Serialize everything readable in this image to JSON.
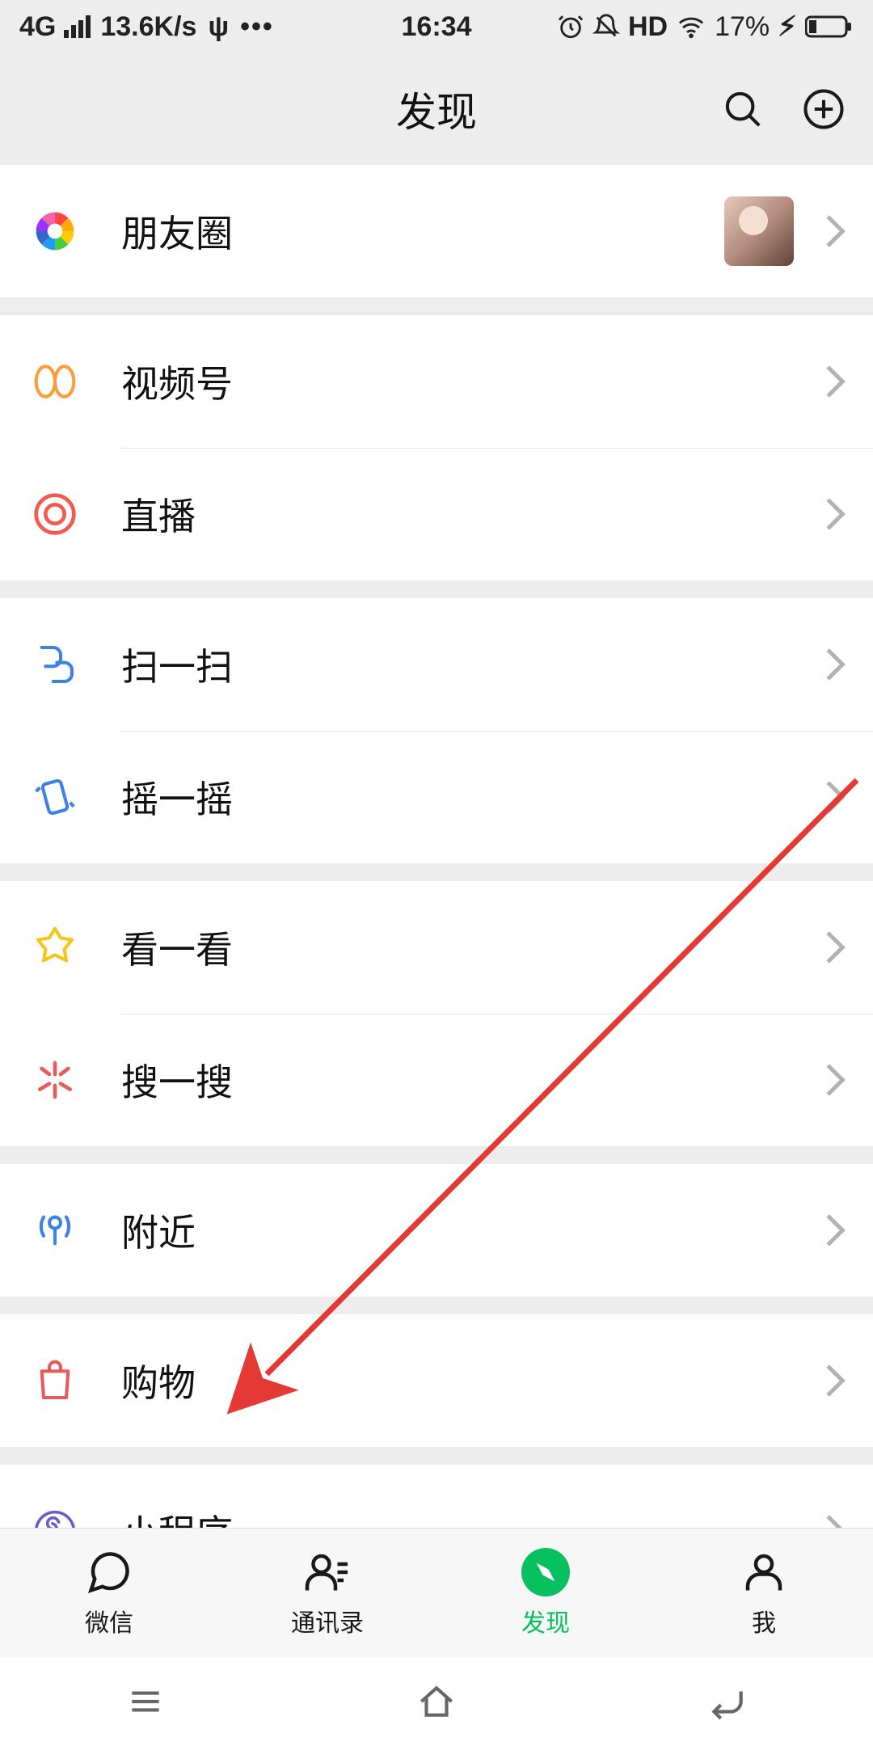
{
  "status": {
    "network": "4G",
    "speed": "13.6K/s",
    "time": "16:34",
    "hd": "HD",
    "battery": "17%"
  },
  "header": {
    "title": "发现"
  },
  "items": {
    "moments": "朋友圈",
    "channels": "视频号",
    "live": "直播",
    "scan": "扫一扫",
    "shake": "摇一摇",
    "topstories": "看一看",
    "search": "搜一搜",
    "nearby": "附近",
    "shopping": "购物",
    "miniprograms": "小程序"
  },
  "tabs": {
    "chat": "微信",
    "contacts": "通讯录",
    "discover": "发现",
    "me": "我"
  }
}
